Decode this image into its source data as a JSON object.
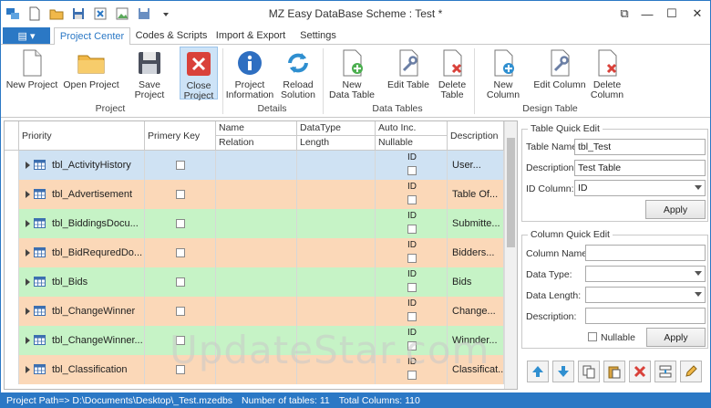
{
  "window": {
    "title": "MZ Easy DataBase Scheme : Test *"
  },
  "quick_access": [
    "app-icon",
    "new-icon",
    "open-folder-icon",
    "save-icon",
    "export-icon",
    "image-icon",
    "save-as-icon",
    "dropdown-icon"
  ],
  "window_controls": {
    "restore": "⧉",
    "minimize": "—",
    "maximize": "☐",
    "close": "✕"
  },
  "tabs": {
    "file_label": "▤ ▾",
    "items": [
      "Project Center",
      "Codes & Scripts",
      "Import & Export",
      "Settings"
    ]
  },
  "ribbon": {
    "buttons": {
      "new_project": [
        "New Project"
      ],
      "open_project": [
        "Open Project"
      ],
      "save_project": [
        "Save Project"
      ],
      "close_project": [
        "Close",
        "Project"
      ],
      "project_info": [
        "Project",
        "Information"
      ],
      "reload_solution": [
        "Reload",
        "Solution"
      ],
      "new_data_table": [
        "New",
        "Data Table"
      ],
      "edit_table": [
        "Edit Table"
      ],
      "delete_table": [
        "Delete",
        "Table"
      ],
      "new_column": [
        "New Column"
      ],
      "edit_column": [
        "Edit Column"
      ],
      "delete_column": [
        "Delete",
        "Column"
      ]
    },
    "groups": {
      "project": "Project",
      "details": "Details",
      "data_tables": "Data Tables",
      "design_table": "Design Table"
    }
  },
  "grid": {
    "headers": {
      "priority": "Priority",
      "primary_key": "Primery Key",
      "name": "Name",
      "relation": "Relation",
      "datatype": "DataType",
      "length": "Length",
      "auto_inc": "Auto Inc.",
      "nullable": "Nullable",
      "description": "Description"
    },
    "rows": [
      {
        "name": "tbl_ActivityHistory",
        "id": "ID",
        "desc": "User...",
        "color": "#cfe2f3"
      },
      {
        "name": "tbl_Advertisement",
        "id": "ID",
        "desc": "Table Of...",
        "color": "#fbd8b8"
      },
      {
        "name": "tbl_BiddingsDocu...",
        "id": "ID",
        "desc": "Submitte...",
        "color": "#c6f3c6"
      },
      {
        "name": "tbl_BidRequredDo...",
        "id": "ID",
        "desc": "Bidders...",
        "color": "#fbd8b8"
      },
      {
        "name": "tbl_Bids",
        "id": "ID",
        "desc": "Bids",
        "color": "#c6f3c6"
      },
      {
        "name": "tbl_ChangeWinner",
        "id": "ID",
        "desc": "Change...",
        "color": "#fbd8b8"
      },
      {
        "name": "tbl_ChangeWinner...",
        "id": "ID",
        "desc": "Winnder...",
        "color": "#c6f3c6"
      },
      {
        "name": "tbl_Classification",
        "id": "ID",
        "desc": "Classificat...",
        "color": "#fbd8b8"
      }
    ]
  },
  "table_quick_edit": {
    "title": "Table Quick Edit",
    "table_name_label": "Table Name:",
    "table_name_value": "tbl_Test",
    "description_label": "Description:",
    "description_value": "Test Table",
    "id_column_label": "ID Column:",
    "id_column_value": "ID",
    "apply_label": "Apply"
  },
  "column_quick_edit": {
    "title": "Column Quick Edit",
    "column_name_label": "Column Name:",
    "data_type_label": "Data Type:",
    "data_length_label": "Data Length:",
    "description_label": "Description:",
    "nullable_label": "Nullable",
    "apply_label": "Apply"
  },
  "status": {
    "project_path": "Project Path=> D:\\Documents\\Desktop\\_Test.mzedbs",
    "tables": "Number of tables: 11",
    "columns": "Total Columns: 110"
  },
  "watermark": "UpdateStar.com"
}
